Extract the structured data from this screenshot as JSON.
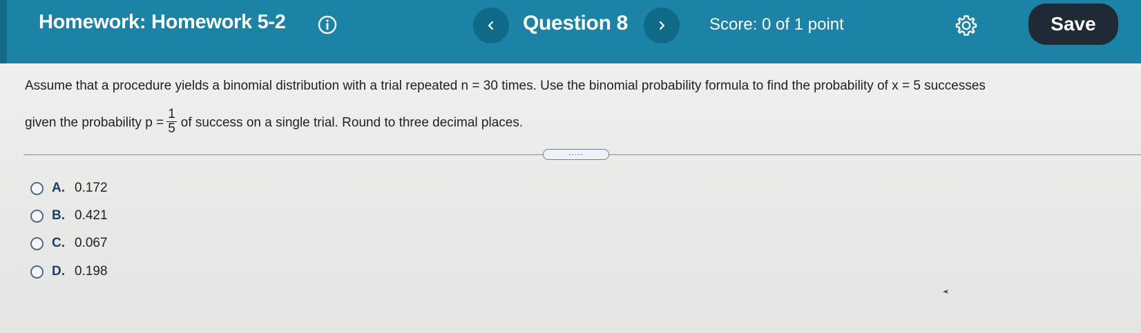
{
  "header": {
    "homework_title": "Homework: Homework 5-2",
    "info_icon": "info-circle-icon",
    "prev_icon": "chevron-left-icon",
    "question_title": "Question 8",
    "next_icon": "chevron-right-icon",
    "score": "Score: 0 of 1 point",
    "settings_icon": "gear-icon",
    "save_label": "Save",
    "colors": {
      "bar": "#1a83a6",
      "nav_button": "#0f6a88",
      "save_button": "#1f2a36"
    }
  },
  "question": {
    "line1": "Assume that a procedure yields a binomial distribution with a trial repeated n = 30 times. Use the binomial probability formula to find the probability of x = 5 successes",
    "line2_before": "given the probability p =",
    "fraction_numerator": "1",
    "fraction_denominator": "5",
    "line2_after": "of success on a single trial. Round to three decimal places."
  },
  "expand_button": {
    "label": "....."
  },
  "options": [
    {
      "letter": "A.",
      "value": "0.172"
    },
    {
      "letter": "B.",
      "value": "0.421"
    },
    {
      "letter": "C.",
      "value": "0.067"
    },
    {
      "letter": "D.",
      "value": "0.198"
    }
  ]
}
